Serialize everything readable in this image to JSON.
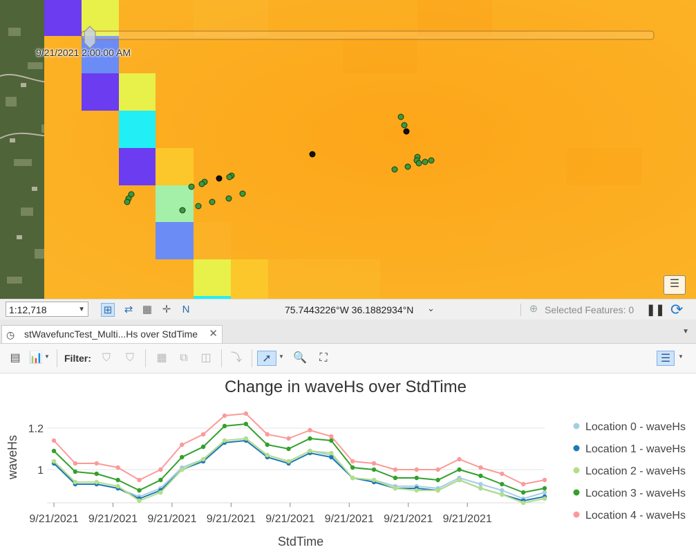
{
  "map": {
    "time_label": "9/21/2021 2:00:00 AM",
    "colors": {
      "orange": "#fca81c",
      "purple": "#6b3cf0",
      "yellow_green": "#e8f04a",
      "cyan": "#22eef5",
      "light_blue": "#6b8cf5",
      "mint": "#a4f0a8",
      "gold": "#fcc72a"
    },
    "raster_rows": [
      {
        "day": "9/21/2021",
        "hour": 0,
        "cells": [
          "purple",
          "yellow_green",
          "orange"
        ]
      },
      {
        "day": "9/21/2021",
        "hour": 1,
        "cells": [
          "orange",
          "light_blue",
          "orange"
        ]
      },
      {
        "day": "9/21/2021",
        "hour": 2,
        "cells": [
          "orange",
          "purple",
          "yellow_green"
        ]
      },
      {
        "day": "9/21/2021",
        "hour": 3,
        "cells": [
          "orange",
          "orange",
          "cyan"
        ]
      },
      {
        "day": "9/21/2021",
        "hour": 4,
        "cells": [
          "orange",
          "orange",
          "purple",
          "gold"
        ]
      },
      {
        "day": "9/21/2021",
        "hour": 5,
        "cells": [
          "orange",
          "orange",
          "orange",
          "mint"
        ]
      },
      {
        "day": "9/21/2021",
        "hour": 6,
        "cells": [
          "orange",
          "orange",
          "orange",
          "light_blue"
        ]
      },
      {
        "day": "9/21/2021",
        "hour": 7,
        "cells": [
          "orange",
          "orange",
          "orange",
          "orange",
          "yellow_green"
        ]
      }
    ],
    "green_points": [
      [
        580,
        169
      ],
      [
        585,
        181
      ],
      [
        604,
        227
      ],
      [
        603,
        232
      ],
      [
        606,
        236
      ],
      [
        615,
        234
      ],
      [
        624,
        232
      ],
      [
        590,
        241
      ],
      [
        571,
        245
      ],
      [
        335,
        254
      ],
      [
        332,
        256
      ],
      [
        296,
        263
      ],
      [
        292,
        266
      ],
      [
        277,
        270
      ],
      [
        351,
        280
      ],
      [
        331,
        287
      ],
      [
        307,
        292
      ],
      [
        287,
        298
      ],
      [
        264,
        304
      ],
      [
        190,
        281
      ],
      [
        186,
        287
      ],
      [
        184,
        292
      ]
    ],
    "black_points": [
      [
        588,
        190
      ],
      [
        452,
        223
      ],
      [
        317,
        258
      ]
    ]
  },
  "status_bar": {
    "scale": "1:12,718",
    "coordinates": "75.7443226°W 36.1882934°N",
    "selected_features": "Selected Features: 0"
  },
  "tab": {
    "title": "stWavefuncTest_Multi...Hs over StdTime"
  },
  "toolbar": {
    "filter_label": "Filter:"
  },
  "chart_data": {
    "type": "line",
    "title": "Change in waveHs over StdTime",
    "xlabel": "StdTime",
    "ylabel": "waveHs",
    "x_tick_labels": [
      "9/21/2021",
      "9/21/2021",
      "9/21/2021",
      "9/21/2021",
      "9/21/2021",
      "9/21/2021",
      "9/21/2021",
      "9/21/2021"
    ],
    "y_ticks": [
      1,
      1.2
    ],
    "y_tick_labels": [
      "1",
      "1.2"
    ],
    "ylim": [
      0.84,
      1.27
    ],
    "grid": true,
    "legend_position": "right",
    "series": [
      {
        "name": "Location 0 - waveHs",
        "color": "#a6cee3",
        "values": [
          1.04,
          0.93,
          0.93,
          0.91,
          0.87,
          0.91,
          1.01,
          1.05,
          1.14,
          1.15,
          1.07,
          1.04,
          1.09,
          1.07,
          0.96,
          0.95,
          0.92,
          0.92,
          0.91,
          0.96,
          0.93,
          0.9,
          0.86,
          0.89
        ]
      },
      {
        "name": "Location 1 - waveHs",
        "color": "#1f78b4",
        "values": [
          1.03,
          0.93,
          0.93,
          0.91,
          0.86,
          0.9,
          1.0,
          1.04,
          1.13,
          1.14,
          1.06,
          1.03,
          1.08,
          1.06,
          0.96,
          0.94,
          0.91,
          0.91,
          0.9,
          0.95,
          0.91,
          0.88,
          0.85,
          0.87
        ]
      },
      {
        "name": "Location 2 - waveHs",
        "color": "#b2df8a",
        "values": [
          1.04,
          0.94,
          0.94,
          0.92,
          0.85,
          0.89,
          1.0,
          1.05,
          1.14,
          1.15,
          1.07,
          1.04,
          1.09,
          1.08,
          0.96,
          0.95,
          0.91,
          0.9,
          0.9,
          0.95,
          0.91,
          0.88,
          0.84,
          0.86
        ]
      },
      {
        "name": "Location 3 - waveHs",
        "color": "#33a02c",
        "values": [
          1.09,
          0.99,
          0.98,
          0.95,
          0.9,
          0.95,
          1.06,
          1.11,
          1.21,
          1.22,
          1.12,
          1.1,
          1.15,
          1.14,
          1.01,
          1.0,
          0.96,
          0.96,
          0.95,
          1.0,
          0.97,
          0.93,
          0.89,
          0.91
        ]
      },
      {
        "name": "Location 4 - waveHs",
        "color": "#fb9a99",
        "values": [
          1.14,
          1.03,
          1.03,
          1.01,
          0.95,
          1.0,
          1.12,
          1.17,
          1.26,
          1.27,
          1.17,
          1.15,
          1.19,
          1.16,
          1.04,
          1.03,
          1.0,
          1.0,
          1.0,
          1.05,
          1.01,
          0.98,
          0.93,
          0.95
        ]
      }
    ]
  }
}
